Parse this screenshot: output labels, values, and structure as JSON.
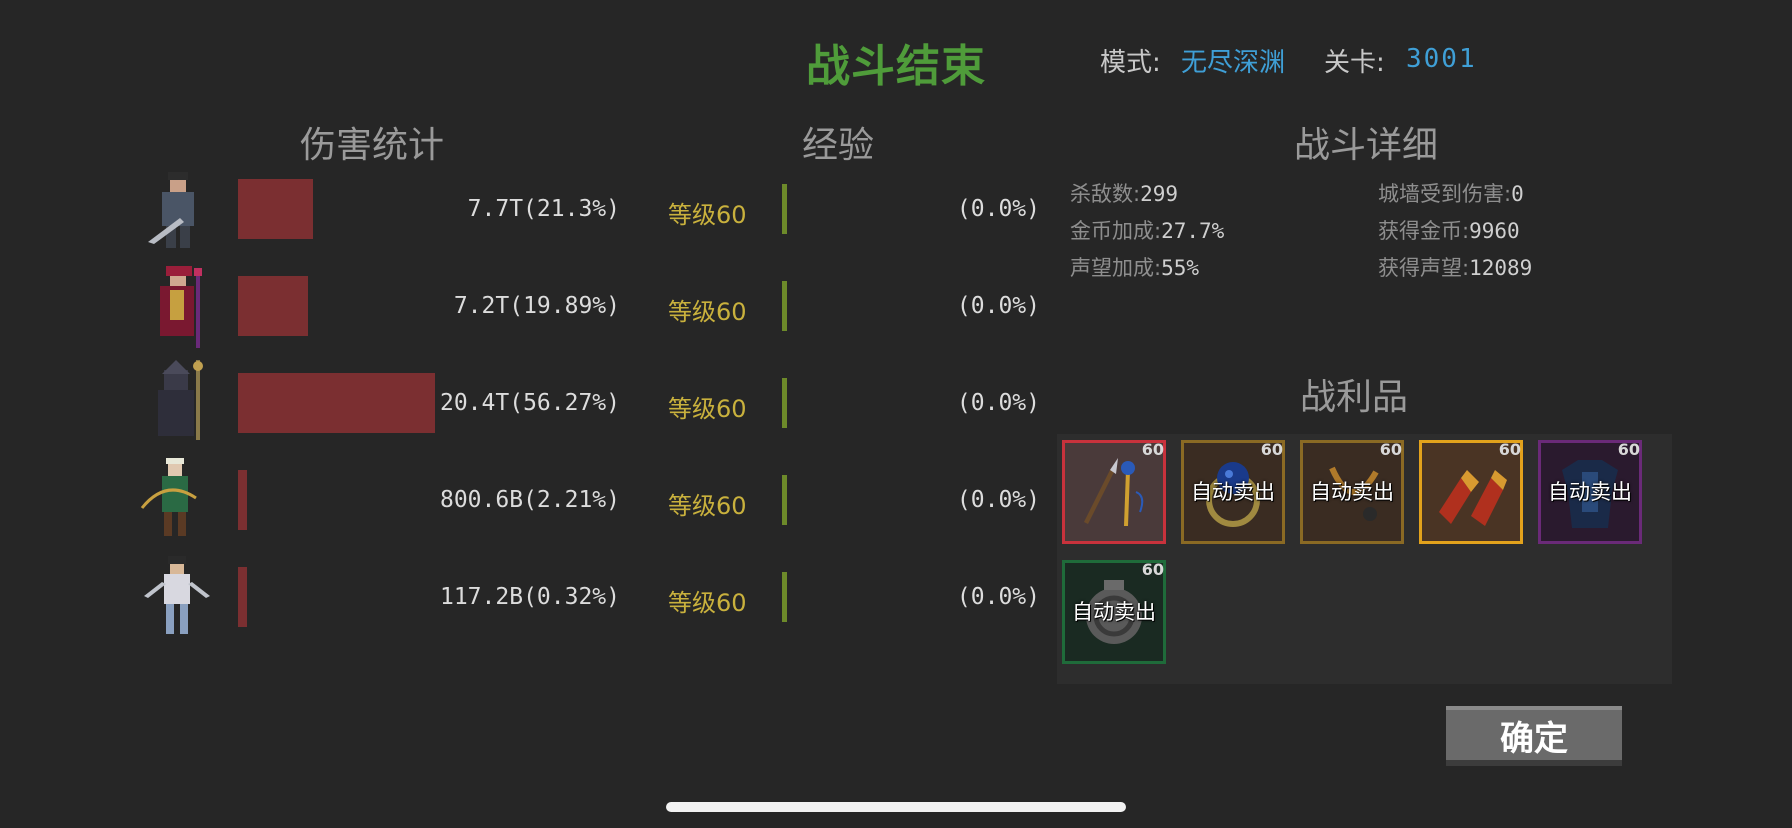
{
  "header": {
    "title": "战斗结束",
    "mode_label": "模式:",
    "mode_value": "无尽深渊",
    "stage_label": "关卡:",
    "stage_value": "3001"
  },
  "sections": {
    "damage": "伤害统计",
    "exp": "经验",
    "details": "战斗详细",
    "loot": "战利品"
  },
  "heroes": [
    {
      "damage": "7.7T(21.3%)",
      "damage_share": 0.213,
      "level": "等级60",
      "exp": "(0.0%)",
      "exp_progress": 0.0
    },
    {
      "damage": "7.2T(19.89%)",
      "damage_share": 0.1989,
      "level": "等级60",
      "exp": "(0.0%)",
      "exp_progress": 0.0
    },
    {
      "damage": "20.4T(56.27%)",
      "damage_share": 0.5627,
      "level": "等级60",
      "exp": "(0.0%)",
      "exp_progress": 0.0
    },
    {
      "damage": "800.6B(2.21%)",
      "damage_share": 0.0221,
      "level": "等级60",
      "exp": "(0.0%)",
      "exp_progress": 0.0
    },
    {
      "damage": "117.2B(0.32%)",
      "damage_share": 0.0032,
      "level": "等级60",
      "exp": "(0.0%)",
      "exp_progress": 0.0
    }
  ],
  "details": {
    "kills_label": "杀敌数:",
    "kills_value": "299",
    "wall_label": "城墙受到伤害:",
    "wall_value": "0",
    "gold_bonus_label": "金币加成:",
    "gold_bonus_value": "27.7%",
    "gold_label": "获得金币:",
    "gold_value": "9960",
    "fame_bonus_label": "声望加成:",
    "fame_bonus_value": "55%",
    "fame_label": "获得声望:",
    "fame_value": "12089"
  },
  "loot": [
    {
      "level": "60",
      "auto_sell": "",
      "rarity_color": "#c8323c",
      "icon": "dual-spear-icon"
    },
    {
      "level": "60",
      "auto_sell": "自动卖出",
      "rarity_color": "#8a6a24",
      "icon": "ring-icon"
    },
    {
      "level": "60",
      "auto_sell": "自动卖出",
      "rarity_color": "#8a6a24",
      "icon": "amulet-icon"
    },
    {
      "level": "60",
      "auto_sell": "",
      "rarity_color": "#e2a21c",
      "icon": "gauntlets-icon"
    },
    {
      "level": "60",
      "auto_sell": "自动卖出",
      "rarity_color": "#6a2a78",
      "icon": "armor-icon"
    },
    {
      "level": "60",
      "auto_sell": "自动卖出",
      "rarity_color": "#1f6b3a",
      "icon": "shield-icon"
    }
  ],
  "confirm": "确定",
  "colors": {
    "background": "#262626",
    "title_green": "#4f9c3a",
    "value_blue": "#3f9fd6",
    "damage_bar": "#7b2f31",
    "level_yellow": "#c9b13d",
    "exp_bar": "#6d8a2a"
  }
}
